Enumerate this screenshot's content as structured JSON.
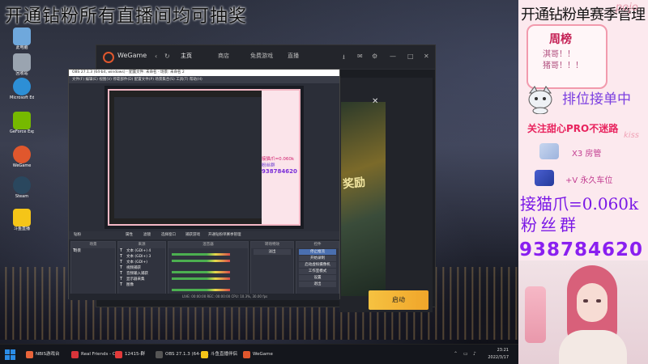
{
  "banner": {
    "text": "开通钻粉所有直播间均可抽奖"
  },
  "desktop_icons": [
    {
      "label": "此电脑",
      "color": "#6fa8dc"
    },
    {
      "label": "回收站",
      "color": "#9aa4b0"
    },
    {
      "label": "Microsoft Edge",
      "color": "#2d8fd6"
    },
    {
      "label": "GeForce Experience",
      "color": "#76b900"
    },
    {
      "label": "WeGame",
      "color": "#e0572d"
    },
    {
      "label": "Steam",
      "color": "#2a475e"
    },
    {
      "label": "斗鱼直播",
      "color": "#f5c518"
    }
  ],
  "wegame": {
    "name": "WeGame",
    "nav": [
      "主页",
      "商店",
      "免费游戏",
      "直播"
    ],
    "active_nav_index": 0,
    "banner_text": "奖励",
    "start_button": "启动",
    "close_glyph": "✕"
  },
  "obs": {
    "title": "OBS 27.1.3 (64-bit, windows) - 配置文件: 未命名 - 场景: 未命名 2",
    "menu": "文件(F)  编辑(E)  视图(V)  停靠部件(D)  配置文件(P)  场景集合(S)  工具(T)  帮助(H)",
    "toolbar": [
      "钻粉",
      "属性",
      "滤镜",
      "选择窗口",
      "捕获游戏",
      "开通钻粉单赛季管理"
    ],
    "panels": [
      "场景",
      "来源",
      "混音器",
      "转场特效",
      "控件"
    ],
    "scenes": [
      "场景"
    ],
    "sources": [
      "文本 (GDI+) 4",
      "文本 (GDI+) 3",
      "文本 (GDI+)",
      "视频捕获",
      "音频输入捕获",
      "显示器采集",
      "图像"
    ],
    "controls": [
      "停止推流",
      "开始录制",
      "启动虚拟摄像机",
      "工作室模式",
      "设置",
      "退出"
    ],
    "active_control_index": 0,
    "transition": "淡出",
    "status": "LIVE: 00:00:00   REC: 00:00:00   CPU: 10.3%, 30.00 fps",
    "preview_inner": {
      "lines": [
        "接猫爪=0.060k",
        "粉丝群",
        "938784620"
      ]
    }
  },
  "taskbar": {
    "items": [
      {
        "label": "NBIS游戏台",
        "color": "#e9643a"
      },
      {
        "label": "Real Friends - Ca...",
        "color": "#d8343a"
      },
      {
        "label": "12415-群",
        "color": "#e23a3a"
      },
      {
        "label": "OBS 27.1.3 (64-bi...",
        "color": "#444"
      },
      {
        "label": "斗鱼直播伴侣",
        "color": "#f5c518"
      },
      {
        "label": "WeGame",
        "color": "#e0572d"
      }
    ],
    "time": "23:21",
    "date": "2022/3/17"
  },
  "side_panel": {
    "top_text": "开通钻粉单赛季管理",
    "watermark": "pojo",
    "card_title": "周榜",
    "card_lines": [
      "淇哥！！",
      "猪哥！！！"
    ],
    "rank_text": "排位接单中",
    "follow_text": "关注甜心PRO不迷路",
    "kiss": "kiss",
    "badge1_text": "X3 房管",
    "badge2_text": "+V 永久车位",
    "catclaw": "接猫爪=0.060k",
    "fans_label": "粉丝群",
    "fans_number": "938784620"
  }
}
